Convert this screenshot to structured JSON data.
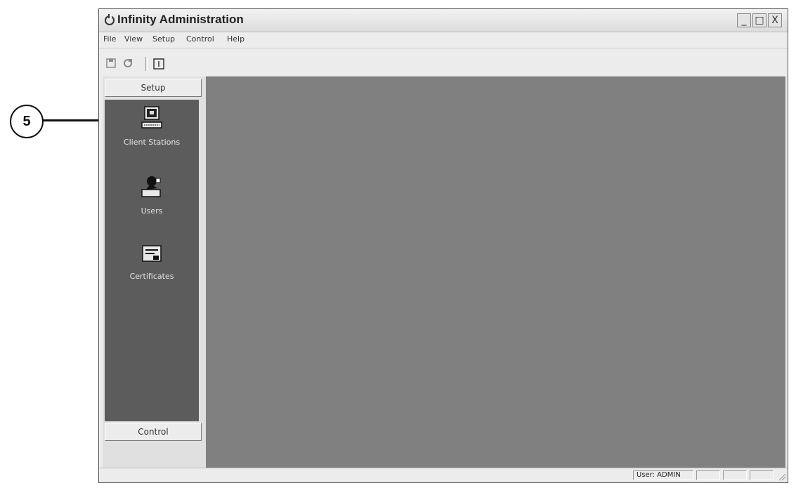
{
  "callout": {
    "number": "5"
  },
  "window": {
    "title": "Infinity Administration",
    "controls": {
      "minimize": "_",
      "maximize": "□",
      "close": "X"
    }
  },
  "menu": [
    "File",
    "View",
    "Setup",
    "Control",
    "Help"
  ],
  "toolbar": {
    "icons": [
      "save-icon",
      "refresh-icon",
      "window-icon"
    ]
  },
  "sidebar": {
    "top_section": "Setup",
    "bottom_section": "Control",
    "items": [
      {
        "label": "Client Stations",
        "icon": "client-stations-icon"
      },
      {
        "label": "Users",
        "icon": "users-icon"
      },
      {
        "label": "Certificates",
        "icon": "certificates-icon"
      }
    ]
  },
  "statusbar": {
    "user": "User: ADMIN"
  }
}
